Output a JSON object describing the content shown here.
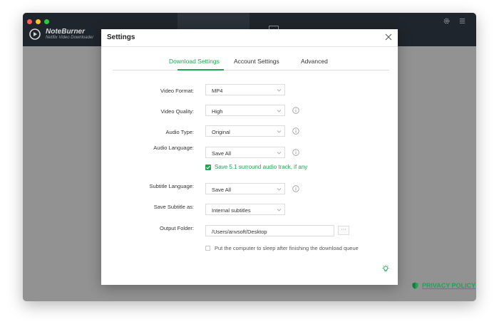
{
  "app": {
    "brand_name": "NoteBurner",
    "brand_sub": "Netflix Video Downloader",
    "privacy_label": "PRIVACY POLICY",
    "accent_color": "#1fa551"
  },
  "dialog": {
    "title": "Settings",
    "tabs": [
      {
        "label": "Download Settings",
        "active": true
      },
      {
        "label": "Account Settings",
        "active": false
      },
      {
        "label": "Advanced",
        "active": false
      }
    ],
    "fields": {
      "video_format": {
        "label": "Video Format:",
        "value": "MP4"
      },
      "video_quality": {
        "label": "Video Quality:",
        "value": "High"
      },
      "audio_type": {
        "label": "Audio Type:",
        "value": "Original"
      },
      "audio_language": {
        "label": "Audio Language:",
        "value": "Save All"
      },
      "surround": {
        "label": "Save 5.1 surround audio track, if any",
        "checked": true
      },
      "subtitle_language": {
        "label": "Subtitle Language:",
        "value": "Save All"
      },
      "save_subtitle_as": {
        "label": "Save Subtitle as:",
        "value": "Internal subtitles"
      },
      "output_folder": {
        "label": "Output Folder:",
        "value": "/Users/anvsoft/Desktop",
        "browse_label": "···"
      },
      "sleep": {
        "label": "Put the computer to sleep after finishing the download queue",
        "checked": false
      }
    }
  }
}
